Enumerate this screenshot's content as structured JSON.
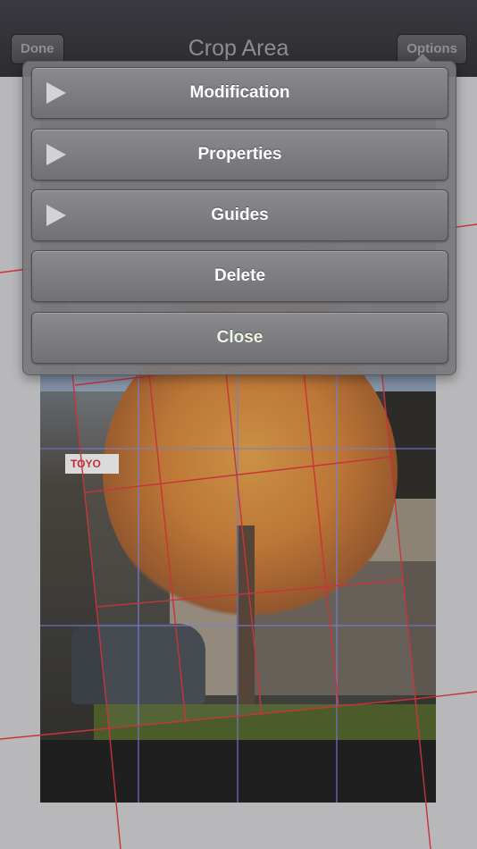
{
  "navbar": {
    "title": "Crop Area",
    "done_label": "Done",
    "options_label": "Options"
  },
  "photo": {
    "sign_text": "TOYO"
  },
  "menu": {
    "items": [
      {
        "label": "Modification",
        "icon": "play-triangle-icon"
      },
      {
        "label": "Properties",
        "icon": "play-triangle-icon"
      },
      {
        "label": "Guides",
        "icon": "play-triangle-icon"
      },
      {
        "label": "Delete"
      },
      {
        "label": "Close"
      }
    ]
  },
  "colors": {
    "navbar": "#2f2f34",
    "crop_grid": "#c8343a",
    "guide_grid": "#6d78c8",
    "menu_background": "#7a7a7e",
    "close_text": "#eef5e2"
  }
}
